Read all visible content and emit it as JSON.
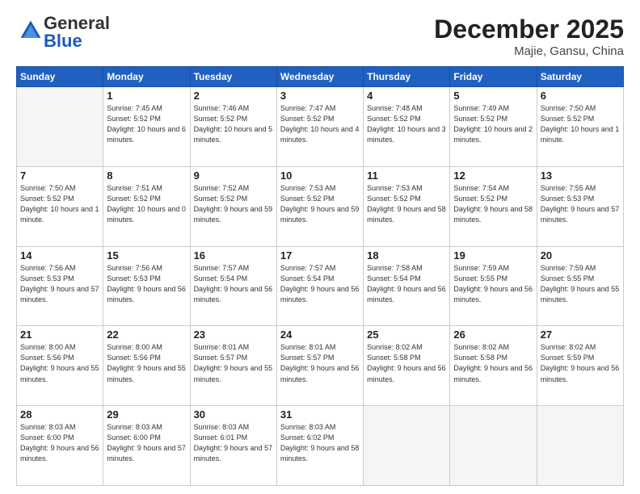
{
  "header": {
    "logo_general": "General",
    "logo_blue": "Blue",
    "month": "December 2025",
    "location": "Majie, Gansu, China"
  },
  "days_of_week": [
    "Sunday",
    "Monday",
    "Tuesday",
    "Wednesday",
    "Thursday",
    "Friday",
    "Saturday"
  ],
  "weeks": [
    [
      {
        "day": "",
        "empty": true
      },
      {
        "day": "1",
        "sunrise": "7:45 AM",
        "sunset": "5:52 PM",
        "daylight": "10 hours and 6 minutes."
      },
      {
        "day": "2",
        "sunrise": "7:46 AM",
        "sunset": "5:52 PM",
        "daylight": "10 hours and 5 minutes."
      },
      {
        "day": "3",
        "sunrise": "7:47 AM",
        "sunset": "5:52 PM",
        "daylight": "10 hours and 4 minutes."
      },
      {
        "day": "4",
        "sunrise": "7:48 AM",
        "sunset": "5:52 PM",
        "daylight": "10 hours and 3 minutes."
      },
      {
        "day": "5",
        "sunrise": "7:49 AM",
        "sunset": "5:52 PM",
        "daylight": "10 hours and 2 minutes."
      },
      {
        "day": "6",
        "sunrise": "7:50 AM",
        "sunset": "5:52 PM",
        "daylight": "10 hours and 1 minute."
      }
    ],
    [
      {
        "day": "7",
        "sunrise": "7:50 AM",
        "sunset": "5:52 PM",
        "daylight": "10 hours and 1 minute."
      },
      {
        "day": "8",
        "sunrise": "7:51 AM",
        "sunset": "5:52 PM",
        "daylight": "10 hours and 0 minutes."
      },
      {
        "day": "9",
        "sunrise": "7:52 AM",
        "sunset": "5:52 PM",
        "daylight": "9 hours and 59 minutes."
      },
      {
        "day": "10",
        "sunrise": "7:53 AM",
        "sunset": "5:52 PM",
        "daylight": "9 hours and 59 minutes."
      },
      {
        "day": "11",
        "sunrise": "7:53 AM",
        "sunset": "5:52 PM",
        "daylight": "9 hours and 58 minutes."
      },
      {
        "day": "12",
        "sunrise": "7:54 AM",
        "sunset": "5:52 PM",
        "daylight": "9 hours and 58 minutes."
      },
      {
        "day": "13",
        "sunrise": "7:55 AM",
        "sunset": "5:53 PM",
        "daylight": "9 hours and 57 minutes."
      }
    ],
    [
      {
        "day": "14",
        "sunrise": "7:56 AM",
        "sunset": "5:53 PM",
        "daylight": "9 hours and 57 minutes."
      },
      {
        "day": "15",
        "sunrise": "7:56 AM",
        "sunset": "5:53 PM",
        "daylight": "9 hours and 56 minutes."
      },
      {
        "day": "16",
        "sunrise": "7:57 AM",
        "sunset": "5:54 PM",
        "daylight": "9 hours and 56 minutes."
      },
      {
        "day": "17",
        "sunrise": "7:57 AM",
        "sunset": "5:54 PM",
        "daylight": "9 hours and 56 minutes."
      },
      {
        "day": "18",
        "sunrise": "7:58 AM",
        "sunset": "5:54 PM",
        "daylight": "9 hours and 56 minutes."
      },
      {
        "day": "19",
        "sunrise": "7:59 AM",
        "sunset": "5:55 PM",
        "daylight": "9 hours and 56 minutes."
      },
      {
        "day": "20",
        "sunrise": "7:59 AM",
        "sunset": "5:55 PM",
        "daylight": "9 hours and 55 minutes."
      }
    ],
    [
      {
        "day": "21",
        "sunrise": "8:00 AM",
        "sunset": "5:56 PM",
        "daylight": "9 hours and 55 minutes."
      },
      {
        "day": "22",
        "sunrise": "8:00 AM",
        "sunset": "5:56 PM",
        "daylight": "9 hours and 55 minutes."
      },
      {
        "day": "23",
        "sunrise": "8:01 AM",
        "sunset": "5:57 PM",
        "daylight": "9 hours and 55 minutes."
      },
      {
        "day": "24",
        "sunrise": "8:01 AM",
        "sunset": "5:57 PM",
        "daylight": "9 hours and 56 minutes."
      },
      {
        "day": "25",
        "sunrise": "8:02 AM",
        "sunset": "5:58 PM",
        "daylight": "9 hours and 56 minutes."
      },
      {
        "day": "26",
        "sunrise": "8:02 AM",
        "sunset": "5:58 PM",
        "daylight": "9 hours and 56 minutes."
      },
      {
        "day": "27",
        "sunrise": "8:02 AM",
        "sunset": "5:59 PM",
        "daylight": "9 hours and 56 minutes."
      }
    ],
    [
      {
        "day": "28",
        "sunrise": "8:03 AM",
        "sunset": "6:00 PM",
        "daylight": "9 hours and 56 minutes."
      },
      {
        "day": "29",
        "sunrise": "8:03 AM",
        "sunset": "6:00 PM",
        "daylight": "9 hours and 57 minutes."
      },
      {
        "day": "30",
        "sunrise": "8:03 AM",
        "sunset": "6:01 PM",
        "daylight": "9 hours and 57 minutes."
      },
      {
        "day": "31",
        "sunrise": "8:03 AM",
        "sunset": "6:02 PM",
        "daylight": "9 hours and 58 minutes."
      },
      {
        "day": "",
        "empty": true
      },
      {
        "day": "",
        "empty": true
      },
      {
        "day": "",
        "empty": true
      }
    ]
  ]
}
